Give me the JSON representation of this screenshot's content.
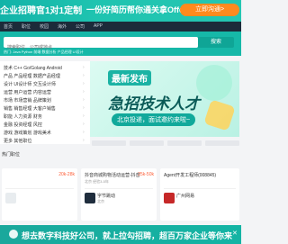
{
  "top_banner": {
    "left_text": "企业招聘官1对1定制",
    "middle_text": "一份好简历帮你通关拿Offer",
    "cta": "立即沟通>"
  },
  "nav": {
    "items": [
      "首页",
      "职位",
      "校园",
      "海外",
      "公司",
      "APP"
    ]
  },
  "search": {
    "placeholder": "搜索职位、公司或地点",
    "button": "搜索",
    "hot_words": "热门: Java  Python  前端  数据分析  产品经理  UI设计"
  },
  "categories": [
    {
      "col1": "技术",
      "col2": "C++",
      "col3": "Go/Golang",
      "col4": "Android"
    },
    {
      "col1": "产品",
      "col2": "产品经理",
      "col3": "数据产品经理",
      "col4": ""
    },
    {
      "col1": "设计",
      "col2": "UI设计师",
      "col3": "交互设计师",
      "col4": ""
    },
    {
      "col1": "运营",
      "col2": "用户运营",
      "col3": "内容运营",
      "col4": ""
    },
    {
      "col1": "市场",
      "col2": "市场营销",
      "col3": "品牌策划",
      "col4": ""
    },
    {
      "col1": "销售",
      "col2": "销售经理",
      "col3": "大客户销售",
      "col4": ""
    },
    {
      "col1": "职能",
      "col2": "人力资源",
      "col3": "财务",
      "col4": ""
    },
    {
      "col1": "金融",
      "col2": "投资经理",
      "col3": "风控",
      "col4": ""
    },
    {
      "col1": "游戏",
      "col2": "游戏策划",
      "col3": "游戏美术",
      "col4": ""
    },
    {
      "col1": "更多",
      "col2": "其他职位",
      "col3": "",
      "col4": ""
    }
  ],
  "promo": {
    "badge": "最新发布",
    "headline": "急招技术人才",
    "subline": "北京投递，面试邀约来啦~"
  },
  "hot_section": {
    "title": "热门职位"
  },
  "cards": [
    {
      "title": "",
      "salary": "20k-28k",
      "meta": "",
      "company": "",
      "company_sub": ""
    },
    {
      "title": "抖音商城购物活动运营-抖音",
      "salary": "25k-50k",
      "meta": "北京 经验3-5年",
      "company": "字节跳动",
      "company_sub": "北京"
    },
    {
      "title": "Agent开发工程师(008845)",
      "salary": "",
      "meta": "",
      "company": "广州网易",
      "company_sub": ""
    }
  ],
  "bottom_banner": {
    "text": "想去数字科技好公司，就上拉勾招聘，超百万家企业等你来"
  },
  "colors": {
    "brand": "#16b8a8",
    "salary": "#fd5f39",
    "nav": "#1c2b3a"
  }
}
